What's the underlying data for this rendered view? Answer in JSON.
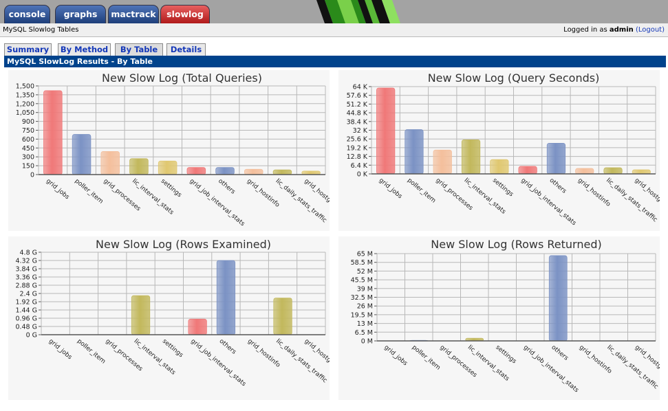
{
  "nav": {
    "tabs": [
      {
        "label": "console",
        "color": "blue"
      },
      {
        "label": "graphs",
        "color": "blue"
      },
      {
        "label": "mactrack",
        "color": "blue"
      },
      {
        "label": "slowlog",
        "color": "red"
      }
    ]
  },
  "subbar": {
    "page_title": "MySQL Slowlog Tables",
    "logged_in_prefix": "Logged in as",
    "user": "admin",
    "logout_label": "(Logout)"
  },
  "content_tabs": [
    "Summary",
    "By Method",
    "By Table",
    "Details"
  ],
  "selected_tab": "By Table",
  "section_header": "MySQL SlowLog Results - By Table",
  "colors": {
    "header_bg": "#00438c",
    "link": "#1538b8",
    "bar_palette": [
      "#f07878",
      "#7b92c4",
      "#f4bf9c",
      "#c2b85c",
      "#e0c870"
    ]
  },
  "chart_data": [
    {
      "type": "bar",
      "title": "New Slow Log (Total Queries)",
      "categories": [
        "grid_jobs",
        "poller_item",
        "grid_processes",
        "lic_interval_stats",
        "settings",
        "grid_job_interval_stats",
        "others",
        "grid_hostinfo",
        "lic_daily_stats_traffic",
        "grid_hostgroups"
      ],
      "values": [
        1420,
        680,
        390,
        270,
        230,
        120,
        120,
        90,
        80,
        60
      ],
      "colors": [
        "#f07878",
        "#7b92c4",
        "#f4bf9c",
        "#c2b85c",
        "#e0c870",
        "#f07878",
        "#7b92c4",
        "#f4bf9c",
        "#c2b85c",
        "#e0c870"
      ],
      "ylim": [
        0,
        1500
      ],
      "yticks": [
        "0",
        "150",
        "300",
        "450",
        "600",
        "750",
        "900",
        "1,050",
        "1,200",
        "1,350",
        "1,500"
      ],
      "grid": true
    },
    {
      "type": "bar",
      "title": "New Slow Log (Query Seconds)",
      "categories": [
        "grid_jobs",
        "poller_item",
        "grid_processes",
        "lic_interval_stats",
        "settings",
        "grid_job_interval_stats",
        "others",
        "grid_hostinfo",
        "lic_daily_stats_traffic",
        "grid_hostgroups"
      ],
      "values": [
        63000,
        32500,
        17500,
        25000,
        10500,
        5500,
        22500,
        4000,
        4500,
        3000
      ],
      "colors": [
        "#f07878",
        "#7b92c4",
        "#f4bf9c",
        "#c2b85c",
        "#e0c870",
        "#f07878",
        "#7b92c4",
        "#f4bf9c",
        "#c2b85c",
        "#e0c870"
      ],
      "ylim": [
        0,
        64000
      ],
      "yticks": [
        "0 K",
        "6.4 K",
        "12.8 K",
        "19.2 K",
        "25.6 K",
        "32 K",
        "38.4 K",
        "44.8 K",
        "51.2 K",
        "57.6 K",
        "64 K"
      ],
      "grid": true
    },
    {
      "type": "bar",
      "title": "New Slow Log (Rows Examined)",
      "categories": [
        "grid_jobs",
        "poller_item",
        "grid_processes",
        "lic_interval_stats",
        "settings",
        "grid_job_interval_stats",
        "others",
        "grid_hostinfo",
        "lic_daily_stats_traffic",
        "grid_hostgroups"
      ],
      "values": [
        0.02,
        0.02,
        0,
        2.5,
        0,
        1.0,
        4.75,
        0,
        2.35,
        0
      ],
      "colors": [
        "#f07878",
        "#7b92c4",
        "#f4bf9c",
        "#c2b85c",
        "#e0c870",
        "#f07878",
        "#7b92c4",
        "#f4bf9c",
        "#c2b85c",
        "#e0c870"
      ],
      "ylim": [
        0,
        5.28
      ],
      "yticks": [
        "0 G",
        "0.48 G",
        "0.96 G",
        "1.44 G",
        "1.92 G",
        "2.4 G",
        "2.88 G",
        "3.36 G",
        "3.84 G",
        "4.32 G",
        "4.8 G"
      ],
      "grid": true
    },
    {
      "type": "bar",
      "title": "New Slow Log (Rows Returned)",
      "categories": [
        "grid_jobs",
        "poller_item",
        "grid_processes",
        "lic_interval_stats",
        "settings",
        "grid_job_interval_stats",
        "others",
        "grid_hostinfo",
        "lic_daily_stats_traffic",
        "grid_hostgroups"
      ],
      "values": [
        0.1,
        0.4,
        0,
        2.0,
        0,
        0,
        63.5,
        0.05,
        0,
        0
      ],
      "colors": [
        "#f07878",
        "#7b92c4",
        "#f4bf9c",
        "#c2b85c",
        "#e0c870",
        "#f07878",
        "#7b92c4",
        "#f4bf9c",
        "#c2b85c",
        "#e0c870"
      ],
      "ylim": [
        0,
        65
      ],
      "yticks": [
        "0 M",
        "6.5 M",
        "13 M",
        "19.5 M",
        "26 M",
        "32.5 M",
        "39 M",
        "45.5 M",
        "52 M",
        "58.5 M",
        "65 M"
      ],
      "grid": true
    }
  ]
}
